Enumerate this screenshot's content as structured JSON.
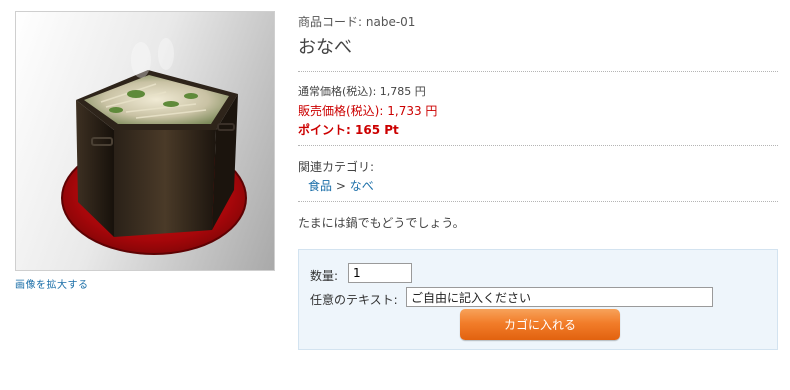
{
  "product": {
    "code_label": "商品コード:",
    "code_value": "nabe-01",
    "name": "おなべ",
    "regular_price_label": "通常価格(税込):",
    "regular_price_value": "1,785 円",
    "sale_price_label": "販売価格(税込):",
    "sale_price_value": "1,733 円",
    "points_label": "ポイント:",
    "points_value": "165 Pt",
    "category_label": "関連カテゴリ:",
    "category_path": [
      "食品",
      "なべ"
    ],
    "category_separator": ">",
    "description": "たまには鍋でもどうでしょう。",
    "enlarge_image_link": "画像を拡大する"
  },
  "cart_form": {
    "quantity_label": "数量:",
    "quantity_value": "1",
    "free_text_label": "任意のテキスト:",
    "free_text_value": "ご自由に記入ください",
    "add_to_cart_label": "カゴに入れる"
  },
  "colors": {
    "sale_price": "#cc0000",
    "link": "#1a6ea8",
    "cart_box_bg": "#eef5fb",
    "button": "#f27d2a"
  }
}
